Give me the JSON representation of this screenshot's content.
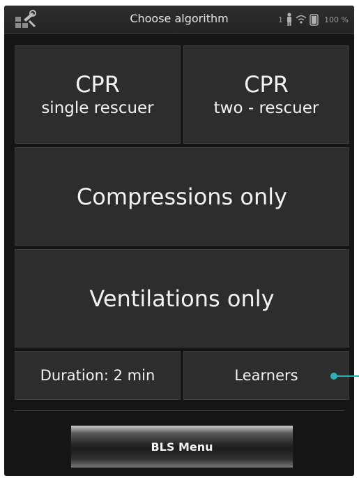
{
  "statusbar": {
    "title": "Choose algorithm",
    "users_count": "1",
    "battery_percent": "100 %",
    "icons": [
      "tools-icon",
      "person-icon",
      "wifi-icon",
      "battery-icon"
    ]
  },
  "tiles": {
    "cpr_single": {
      "line1": "CPR",
      "line2": "single rescuer"
    },
    "cpr_two": {
      "line1": "CPR",
      "line2": "two - rescuer"
    },
    "compressions": {
      "label": "Compressions only"
    },
    "ventilations": {
      "label": "Ventilations only"
    },
    "duration": {
      "label": "Duration: 2 min"
    },
    "learners": {
      "label": "Learners"
    }
  },
  "footer": {
    "bls_menu_label": "BLS Menu"
  },
  "colors": {
    "background": "#151515",
    "tile": "#2d2d2d",
    "text": "#f2f2f2",
    "callout": "#2db1b4"
  }
}
